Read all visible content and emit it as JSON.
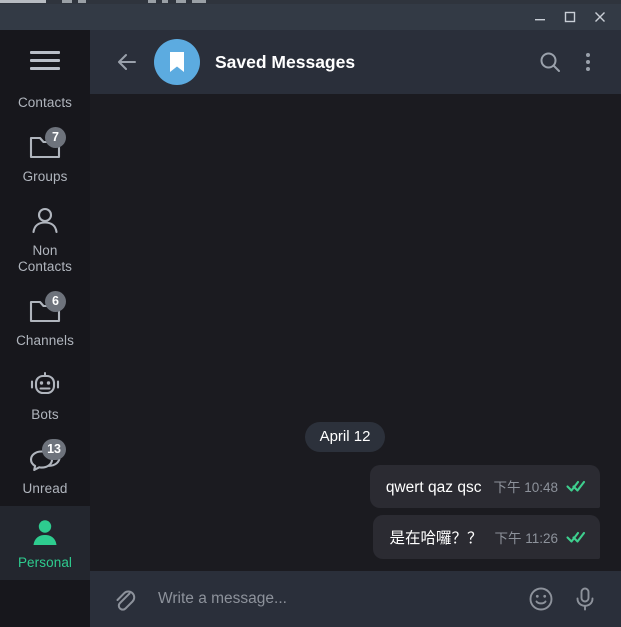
{
  "window": {
    "controls": [
      {
        "name": "minimize",
        "glyph": "minimize-icon"
      },
      {
        "name": "maximize",
        "glyph": "maximize-icon"
      },
      {
        "name": "close",
        "glyph": "close-icon"
      }
    ]
  },
  "sidebar": {
    "menu_button": "menu-icon",
    "items": [
      {
        "label": "Contacts",
        "icon": "folder-icon",
        "badge": "",
        "active": false,
        "partial": true
      },
      {
        "label": "Groups",
        "icon": "folder-icon",
        "badge": "7",
        "active": false,
        "partial": false
      },
      {
        "label": "Non\nContacts",
        "icon": "person-icon",
        "badge": "",
        "active": false,
        "partial": false
      },
      {
        "label": "Channels",
        "icon": "folder-icon",
        "badge": "6",
        "active": false,
        "partial": false
      },
      {
        "label": "Bots",
        "icon": "robot-icon",
        "badge": "",
        "active": false,
        "partial": false
      },
      {
        "label": "Unread",
        "icon": "chat-bubbles-icon",
        "badge": "13",
        "active": false,
        "partial": false
      },
      {
        "label": "Personal",
        "icon": "person-filled-icon",
        "badge": "",
        "active": true,
        "partial": false
      }
    ],
    "active_color": "#2ecc8f",
    "badge_color": "#6e737c"
  },
  "header": {
    "back_button": "back-arrow-icon",
    "avatar_icon": "bookmark-icon",
    "avatar_color": "#5cabe0",
    "title": "Saved Messages",
    "search_button": "search-icon",
    "menu_button": "more-vertical-icon"
  },
  "chat": {
    "date_separator": "April 12",
    "messages": [
      {
        "text": "qwert qaz qsc",
        "time": "下午 10:48",
        "status": "read",
        "status_icon": "double-check-icon",
        "outgoing": true
      },
      {
        "text": "是在哈囉？？",
        "time": "下午 11:26",
        "status": "read",
        "status_icon": "double-check-icon",
        "outgoing": true
      }
    ],
    "tick_color": "#3ecf8e"
  },
  "composer": {
    "attach_button": "paperclip-icon",
    "placeholder": "Write a message...",
    "value": "",
    "emoji_button": "smiley-icon",
    "voice_button": "microphone-icon"
  }
}
